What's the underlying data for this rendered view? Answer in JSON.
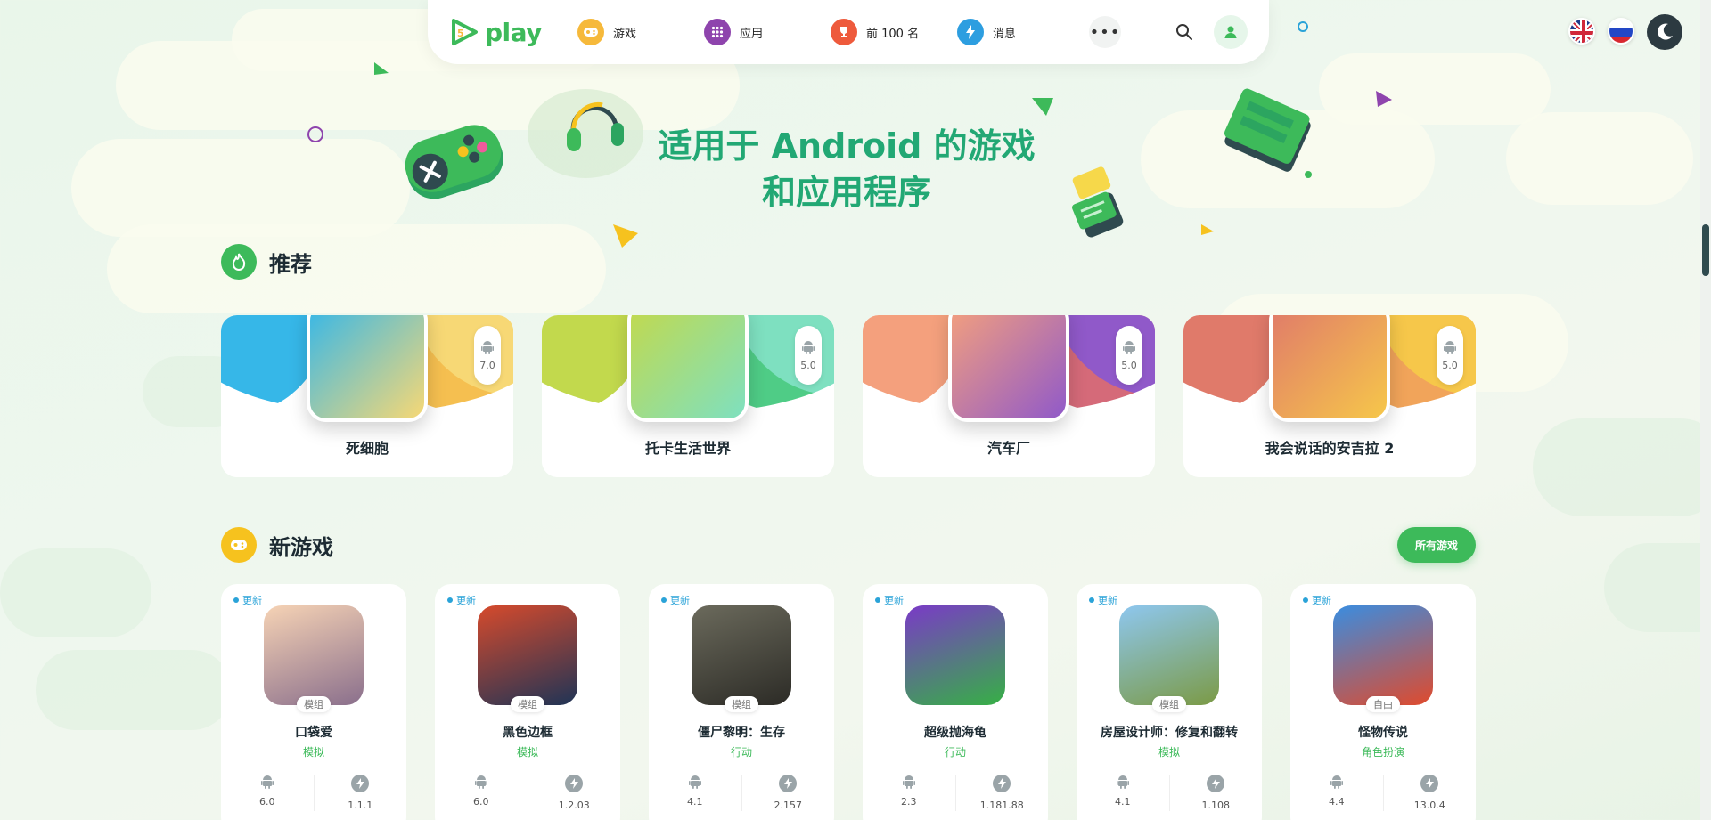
{
  "nav": {
    "logo_text": "play",
    "logo_badge": "5",
    "items": [
      {
        "label": "游戏",
        "icon": "gamepad-icon",
        "color": "#f6b93b"
      },
      {
        "label": "应用",
        "icon": "apps-grid-icon",
        "color": "#8e44ad"
      },
      {
        "label": "前 100 名",
        "icon": "trophy-icon",
        "color": "#ee5a3c"
      },
      {
        "label": "消息",
        "icon": "lightning-icon",
        "color": "#2d9ee0"
      }
    ],
    "more_label": "•••"
  },
  "hero": {
    "line1": "适用于 Android 的游戏",
    "line2": "和应用程序"
  },
  "featured": {
    "title": "推荐",
    "items": [
      {
        "name": "死细胞",
        "android": "7.0",
        "colors": [
          "#36b7e8",
          "#f4b83d",
          "#f7d875"
        ]
      },
      {
        "name": "托卡生活世界",
        "android": "5.0",
        "colors": [
          "#c2d94d",
          "#3cc779",
          "#7ee0c0"
        ]
      },
      {
        "name": "汽车厂",
        "android": "5.0",
        "colors": [
          "#f4a07d",
          "#d05a6a",
          "#9059c9"
        ]
      },
      {
        "name": "我会说话的安吉拉 2",
        "android": "5.0",
        "colors": [
          "#e07a6a",
          "#f09a48",
          "#f6c74a"
        ]
      }
    ]
  },
  "new_games": {
    "title": "新游戏",
    "all_button": "所有游戏",
    "items": [
      {
        "tag": "更新",
        "badge": "模组",
        "name": "口袋爱",
        "category": "模拟",
        "android": "6.0",
        "version": "1.1.1",
        "colors": [
          "#f6d3b5",
          "#8a6f8c"
        ]
      },
      {
        "tag": "更新",
        "badge": "模组",
        "name": "黑色边框",
        "category": "模拟",
        "android": "6.0",
        "version": "1.2.03",
        "colors": [
          "#d64a2c",
          "#1f3456"
        ]
      },
      {
        "tag": "更新",
        "badge": "模组",
        "name": "僵尸黎明：生存",
        "category": "行动",
        "android": "4.1",
        "version": "2.157",
        "colors": [
          "#6b6a5c",
          "#2c2b26"
        ]
      },
      {
        "tag": "更新",
        "badge": "",
        "name": "超级抛海龟",
        "category": "行动",
        "android": "2.3",
        "version": "1.181.88",
        "colors": [
          "#7a3ac7",
          "#36b045"
        ]
      },
      {
        "tag": "更新",
        "badge": "模组",
        "name": "房屋设计师：修复和翻转",
        "category": "模拟",
        "android": "4.1",
        "version": "1.108",
        "colors": [
          "#8ec7ef",
          "#7b9a45"
        ]
      },
      {
        "tag": "更新",
        "badge": "自由",
        "name": "怪物传说",
        "category": "角色扮演",
        "android": "4.4",
        "version": "13.0.4",
        "colors": [
          "#3a8de0",
          "#e04a2c"
        ]
      }
    ]
  }
}
